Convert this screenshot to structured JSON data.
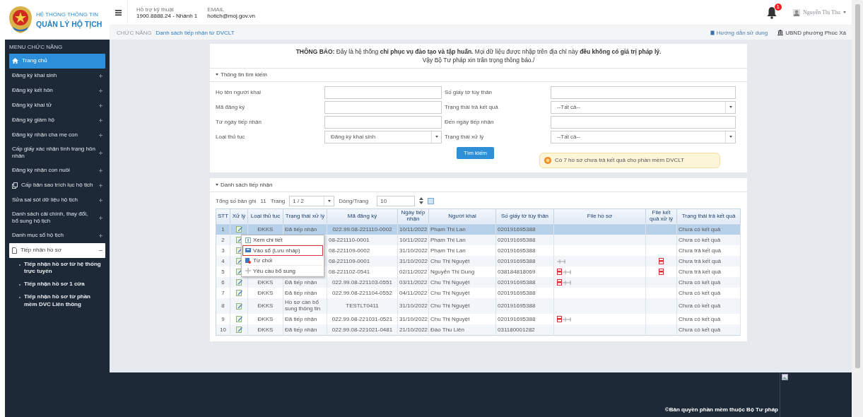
{
  "header": {
    "logo_line1": "HỆ THỐNG THÔNG TIN",
    "logo_line2": "QUẢN LÝ HỘ TỊCH",
    "support": {
      "label": "Hỗ trợ kỹ thuật",
      "value": "1900.8888.24 - Nhánh 1"
    },
    "email": {
      "label": "EMAIL",
      "value": "hotich@moj.gov.vn"
    },
    "notification_count": "1",
    "user": "Nguyễn Thị Thu"
  },
  "breadcrumb": {
    "section": "CHỨC NĂNG",
    "page": "Danh sách tiếp nhận từ DVCLT"
  },
  "top_links": [
    {
      "kind": "guide",
      "label": "Hướng dẫn sử dụng"
    },
    {
      "kind": "office",
      "label": "UBND phường Phúc Xá"
    }
  ],
  "sidebar": {
    "title": "MENU CHỨC NĂNG",
    "items": [
      {
        "label": "Trang chủ",
        "kind": "home",
        "selected": true
      },
      {
        "label": "Đăng ký khai sinh",
        "selected": false,
        "expanded": false
      },
      {
        "label": "Đăng ký kết hôn",
        "selected": false,
        "expanded": false
      },
      {
        "label": "Đăng ký khai tử",
        "selected": false,
        "expanded": false
      },
      {
        "label": "Đăng ký giám hộ",
        "selected": false,
        "expanded": false
      },
      {
        "label": "Đăng ký nhận cha mẹ con",
        "selected": false,
        "expanded": false
      },
      {
        "label": "Cấp giấy xác nhận tình trạng hôn nhân",
        "selected": false,
        "expanded": false
      },
      {
        "label": "Đăng ký nhận con nuôi",
        "selected": false,
        "expanded": false
      },
      {
        "label": "Cấp bản sao trích lục hộ tịch",
        "kind": "copy",
        "selected": false,
        "expanded": false
      },
      {
        "label": "Sửa sai sót dữ liệu hộ tịch",
        "selected": false,
        "expanded": false
      },
      {
        "label": "Danh sách cải chính, thay đổi, bổ sung hộ tịch",
        "selected": false,
        "expanded": false
      },
      {
        "label": "Danh mục sổ hộ tịch",
        "selected": false,
        "expanded": false
      },
      {
        "label": "Tiếp nhận hồ sơ",
        "kind": "document",
        "selected": false,
        "expanded": true,
        "children": [
          {
            "label": "Tiếp nhận hồ sơ từ hệ thống trực tuyến"
          },
          {
            "label": "Tiếp nhận hồ sơ 1 cửa"
          },
          {
            "label": "Tiếp nhận hồ sơ từ phần mềm DVC Liên thông"
          }
        ]
      }
    ]
  },
  "notice": {
    "line1": "**THÔNG BÁO:** Đây là hệ thống **chỉ phục vụ đào tạo và tập huấn.** Mọi dữ liệu được nhập trên địa chỉ này **đều không có giá trị pháp lý.**",
    "line2": "Vậy Bộ Tư pháp xin trân trọng thông báo./"
  },
  "search": {
    "title": "Thông tin tìm kiếm",
    "expanded": true,
    "fields": [
      {
        "kind": "text",
        "label": "Họ tên người khai"
      },
      {
        "kind": "text",
        "label": "Số giấy tờ tùy thân"
      },
      {
        "kind": "text",
        "label": "Mã đăng ký"
      },
      {
        "kind": "select",
        "label": "Trạng thái trả kết quả",
        "value": "--Tất cả--"
      },
      {
        "kind": "text",
        "label": "Từ ngày tiếp nhận"
      },
      {
        "kind": "text",
        "label": "Đến ngày tiếp nhận"
      },
      {
        "kind": "select",
        "label": "Loại thủ tục",
        "value": "Đăng ký khai sinh"
      },
      {
        "kind": "select",
        "label": "Trạng thái xử lý",
        "value": "--Tất cả--"
      }
    ],
    "button": "Tìm kiếm",
    "alert": "Có 7 hồ sơ chưa trả kết quả cho phần mềm DVCLT"
  },
  "list": {
    "title": "Danh sách tiếp nhận",
    "expanded": true,
    "total_label": "Tổng số bản ghi",
    "total": "11",
    "page_label": "Trang",
    "page": "1 / 2",
    "rows_label": "Dòng/Trang",
    "rows_per_page": "10",
    "table": {
      "columns": [
        "STT",
        "Xử lý",
        "Loại thủ tục",
        "Trạng thái xử lý",
        "Mã đăng ký",
        "Ngày tiếp nhận",
        "Người khai",
        "Số giấy tờ tùy thân",
        "File hồ sơ",
        "File kết quả xử lý",
        "Trạng thái trả kết quả"
      ],
      "rows": [
        {
          "stt": "1",
          "selected": true,
          "loai": "ĐKKS",
          "trang_thai": "Đã tiếp nhận",
          "ma": "022.99.08-221110-0002",
          "ngay": "10/11/2022",
          "nguoi_khai": "Phạm Thị Lan",
          "so_giay": "020191695388",
          "ket_qua_file": false,
          "tra_ket_qua": "Chưa có kết quả"
        },
        {
          "stt": "2",
          "selected": false,
          "ma": "08-221110-0001",
          "ngay": "10/11/2022",
          "nguoi_khai": "Phạm Thị Lan",
          "so_giay": "020191695388",
          "ket_qua_file": false,
          "tra_ket_qua": "Chưa có kết quả"
        },
        {
          "stt": "3",
          "selected": false,
          "ma": "08-221109-0002",
          "ngay": "31/10/2022",
          "nguoi_khai": "Phạm Thị Lan",
          "so_giay": "020191695388",
          "ket_qua_file": false,
          "tra_ket_qua": "Chưa trả kết quả"
        },
        {
          "stt": "4",
          "selected": false,
          "ma": "08-221109-0001",
          "ngay": "31/10/2022",
          "nguoi_khai": "Chu Thị Nguyệt",
          "so_giay": "020191695388",
          "ho_so_attachment": true,
          "ho_so_pdf": false,
          "ket_qua_file": true,
          "tra_ket_qua": "Chưa trả kết quả"
        },
        {
          "stt": "5",
          "selected": false,
          "ma": "08-221102-0541",
          "ngay": "02/11/2022",
          "nguoi_khai": "Nguyễn Thị Dung",
          "so_giay": "038184818069",
          "ho_so_attachment": true,
          "ho_so_pdf": true,
          "ket_qua_file": true,
          "tra_ket_qua": "Chưa trả kết quả"
        },
        {
          "stt": "6",
          "selected": false,
          "loai": "ĐKKS",
          "trang_thai": "Đã tiếp nhận",
          "ma": "022.99.08-221103-0551",
          "ngay": "03/11/2022",
          "nguoi_khai": "Chu Thị Nguyệt",
          "so_giay": "020191695388",
          "ho_so_attachment": true,
          "ho_so_pdf": true,
          "ket_qua_file": false,
          "tra_ket_qua": "Chưa có kết quả"
        },
        {
          "stt": "7",
          "selected": false,
          "loai": "ĐKKS",
          "trang_thai": "Đã tiếp nhận",
          "ma": "022.99.08-221104-0552",
          "ngay": "04/11/2022",
          "nguoi_khai": "Chu Thị Nguyệt",
          "so_giay": "020191695388",
          "ket_qua_file": false,
          "tra_ket_qua": "Chưa có kết quả"
        },
        {
          "stt": "8",
          "selected": false,
          "loai": "ĐKKS",
          "trang_thai": "Hồ sơ cần bổ sung thông tin",
          "ma": "TESTLT0411",
          "ngay": "31/10/2022",
          "nguoi_khai": "Chu Thị Nguyệt",
          "so_giay": "020191695388",
          "ket_qua_file": false,
          "tra_ket_qua": "Chưa có kết quả"
        },
        {
          "stt": "9",
          "selected": false,
          "loai": "ĐKKS",
          "trang_thai": "Đã tiếp nhận",
          "ma": "022.99.08-221031-0521",
          "ngay": "31/10/2022",
          "nguoi_khai": "Chu Thị Nguyệt",
          "so_giay": "020191695388",
          "ho_so_attachment": true,
          "ho_so_pdf": true,
          "ket_qua_file": false,
          "tra_ket_qua": "Chưa có kết quả"
        },
        {
          "stt": "10",
          "selected": false,
          "loai": "ĐKKS",
          "trang_thai": "Đã tiếp nhận",
          "ma": "022.99.08-221021-0481",
          "ngay": "21/10/2022",
          "nguoi_khai": "Đào Thu Liên",
          "so_giay": "031180001282",
          "ket_qua_file": false,
          "tra_ket_qua": "Chưa có kết quả"
        }
      ]
    },
    "context_menu": [
      {
        "kind": "view",
        "label": "Xem chi tiết",
        "selected": false
      },
      {
        "kind": "save",
        "label": "Vào sổ (Lưu nháp)",
        "selected": true
      },
      {
        "kind": "reject",
        "label": "Từ chối",
        "selected": false
      },
      {
        "kind": "request",
        "label": "Yêu cầu bổ sung",
        "selected": false
      }
    ]
  },
  "footer": "©Bản quyền phần mềm thuộc Bộ Tư pháp"
}
